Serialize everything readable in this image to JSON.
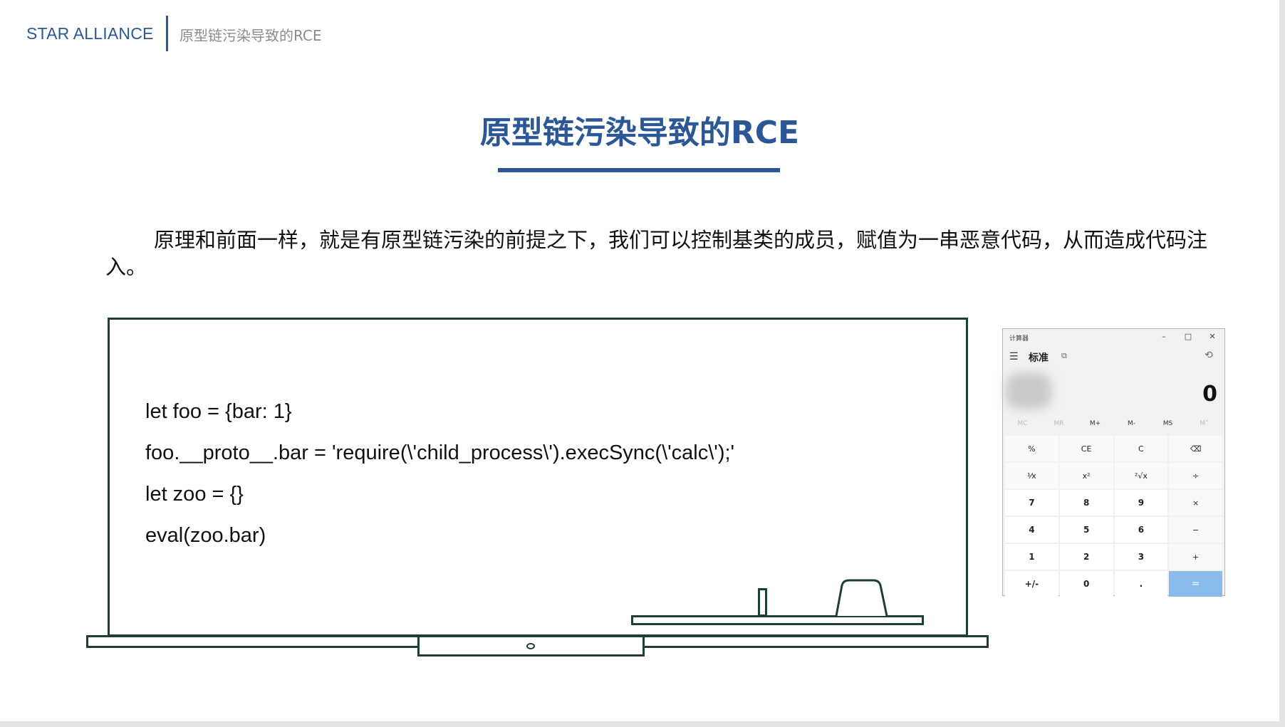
{
  "header": {
    "brand": "STAR ALLIANCE",
    "section": "原型链污染导致的RCE"
  },
  "slide": {
    "title": "原型链污染导致的RCE",
    "paragraph": "原理和前面一样，就是有原型链污染的前提之下，我们可以控制基类的成员，赋值为一串恶意代码，从而造成代码注入。",
    "code_lines": [
      "let foo = {bar: 1}",
      "foo.__proto__.bar = 'require(\\'child_process\\').execSync(\\'calc\\');'",
      "let zoo = {}",
      "eval(zoo.bar)"
    ]
  },
  "calculator": {
    "window_title": "计算器",
    "window_buttons": [
      "–",
      "□",
      "✕"
    ],
    "mode": "标准",
    "display": "0",
    "memory_buttons": [
      {
        "label": "MC",
        "enabled": false
      },
      {
        "label": "MR",
        "enabled": false
      },
      {
        "label": "M+",
        "enabled": true
      },
      {
        "label": "M-",
        "enabled": true
      },
      {
        "label": "MS",
        "enabled": true
      },
      {
        "label": "M˅",
        "enabled": false
      }
    ],
    "keys": [
      {
        "label": "%",
        "name": "percent-key",
        "type": "op"
      },
      {
        "label": "CE",
        "name": "clear-entry-key",
        "type": "op"
      },
      {
        "label": "C",
        "name": "clear-key",
        "type": "op"
      },
      {
        "label": "⌫",
        "name": "backspace-key",
        "type": "op"
      },
      {
        "label": "⅟x",
        "name": "reciprocal-key",
        "type": "op"
      },
      {
        "label": "x²",
        "name": "square-key",
        "type": "op"
      },
      {
        "label": "²√x",
        "name": "sqrt-key",
        "type": "op"
      },
      {
        "label": "÷",
        "name": "divide-key",
        "type": "op"
      },
      {
        "label": "7",
        "name": "digit-7-key",
        "type": "num"
      },
      {
        "label": "8",
        "name": "digit-8-key",
        "type": "num"
      },
      {
        "label": "9",
        "name": "digit-9-key",
        "type": "num"
      },
      {
        "label": "×",
        "name": "multiply-key",
        "type": "op"
      },
      {
        "label": "4",
        "name": "digit-4-key",
        "type": "num"
      },
      {
        "label": "5",
        "name": "digit-5-key",
        "type": "num"
      },
      {
        "label": "6",
        "name": "digit-6-key",
        "type": "num"
      },
      {
        "label": "−",
        "name": "minus-key",
        "type": "op"
      },
      {
        "label": "1",
        "name": "digit-1-key",
        "type": "num"
      },
      {
        "label": "2",
        "name": "digit-2-key",
        "type": "num"
      },
      {
        "label": "3",
        "name": "digit-3-key",
        "type": "num"
      },
      {
        "label": "+",
        "name": "plus-key",
        "type": "op"
      },
      {
        "label": "+/-",
        "name": "negate-key",
        "type": "num"
      },
      {
        "label": "0",
        "name": "digit-0-key",
        "type": "num"
      },
      {
        "label": ".",
        "name": "decimal-key",
        "type": "num"
      },
      {
        "label": "=",
        "name": "equals-key",
        "type": "eq"
      }
    ]
  },
  "colors": {
    "accent": "#2b5797",
    "board_line": "#1d3f38",
    "equals_key": "#88bbe9"
  }
}
